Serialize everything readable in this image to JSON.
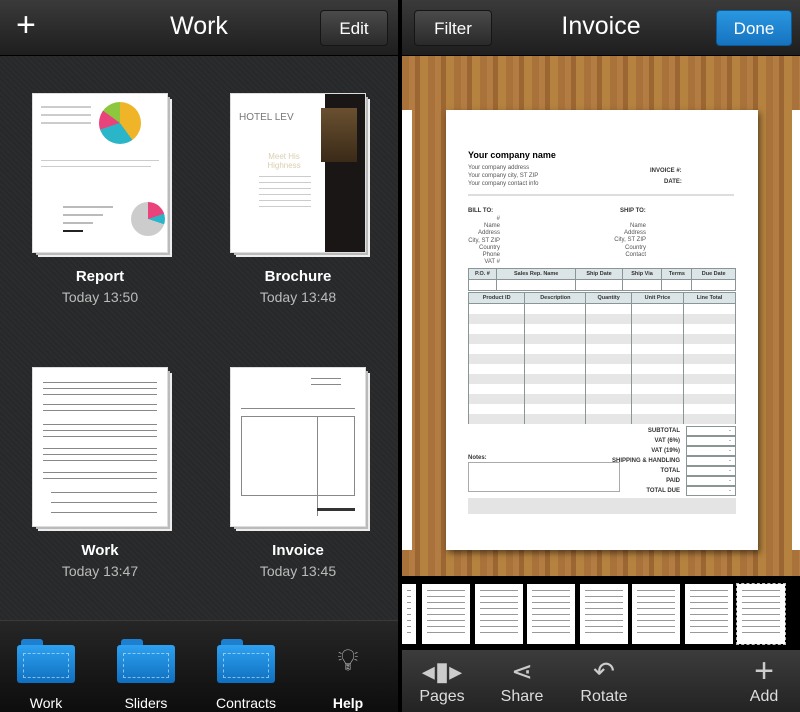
{
  "left": {
    "title": "Work",
    "edit_label": "Edit",
    "add_icon": "plus-icon",
    "documents": [
      {
        "name": "Report",
        "time": "Today 13:50"
      },
      {
        "name": "Brochure",
        "time": "Today 13:48",
        "brand": "HOTEL LEV",
        "heading": "Meet His Highness"
      },
      {
        "name": "Work",
        "time": "Today 13:47"
      },
      {
        "name": "Invoice",
        "time": "Today 13:45"
      }
    ],
    "folders": [
      {
        "label": "Work"
      },
      {
        "label": "Sliders"
      },
      {
        "label": "Contracts"
      }
    ],
    "help_label": "Help"
  },
  "right": {
    "title": "Invoice",
    "filter_label": "Filter",
    "done_label": "Done",
    "invoice": {
      "company": "Your company name",
      "address_lines": [
        "Your company address",
        "Your company city, ST ZIP",
        "Your company contact info"
      ],
      "invoice_no": "INVOICE #:",
      "date": "DATE:",
      "bill_to": "BILL TO:",
      "ship_to": "SHIP TO:",
      "bill_fields": [
        "#",
        "Name",
        "Address",
        "City, ST ZIP",
        "Country",
        "Phone",
        "VAT #"
      ],
      "ship_fields": [
        "Name",
        "Address",
        "City, ST ZIP",
        "Country",
        "Contact"
      ],
      "order_headers": [
        "P.O. #",
        "Sales Rep. Name",
        "Ship Date",
        "Ship Via",
        "Terms",
        "Due Date"
      ],
      "item_headers": [
        "Product ID",
        "Description",
        "Quantity",
        "Unit Price",
        "Line Total"
      ],
      "totals": [
        {
          "label": "SUBTOTAL",
          "value": "-"
        },
        {
          "label": "VAT (6%)",
          "value": "-"
        },
        {
          "label": "VAT (19%)",
          "value": "-"
        },
        {
          "label": "SHIPPING & HANDLING",
          "value": "-"
        },
        {
          "label": "TOTAL",
          "value": "-"
        },
        {
          "label": "PAID",
          "value": "-"
        },
        {
          "label": "TOTAL DUE",
          "value": "-"
        }
      ],
      "notes": "Notes:"
    },
    "toolbar": [
      {
        "label": "Pages",
        "icon": "pages-icon"
      },
      {
        "label": "Share",
        "icon": "share-icon"
      },
      {
        "label": "Rotate",
        "icon": "rotate-icon"
      },
      {
        "label": "Add",
        "icon": "plus-icon"
      }
    ],
    "thumbnail_count": 8,
    "selected_thumbnail": 8
  }
}
